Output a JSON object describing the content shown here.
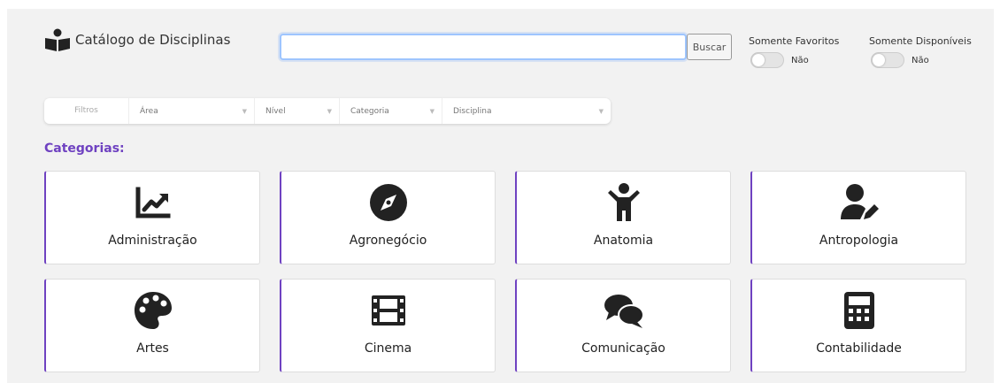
{
  "header": {
    "title": "Catálogo de Disciplinas",
    "search_button": "Buscar",
    "search_value": "",
    "search_placeholder": ""
  },
  "toggles": [
    {
      "label": "Somente Favoritos",
      "state": "Não"
    },
    {
      "label": "Somente Disponíveis",
      "state": "Não"
    }
  ],
  "filters": {
    "label": "Filtros",
    "selects": [
      "Área",
      "Nível",
      "Categoria",
      "Disciplina"
    ]
  },
  "section_title": "Categorias:",
  "categories": [
    {
      "label": "Administração",
      "icon": "chart-line-icon"
    },
    {
      "label": "Agronegócio",
      "icon": "compass-icon"
    },
    {
      "label": "Anatomia",
      "icon": "child-icon"
    },
    {
      "label": "Antropologia",
      "icon": "user-pen-icon"
    },
    {
      "label": "Artes",
      "icon": "palette-icon"
    },
    {
      "label": "Cinema",
      "icon": "film-icon"
    },
    {
      "label": "Comunicação",
      "icon": "comments-icon"
    },
    {
      "label": "Contabilidade",
      "icon": "calculator-icon"
    }
  ],
  "colors": {
    "accent": "#6f42c1",
    "background": "#f2f2f2",
    "icon": "#222222"
  }
}
